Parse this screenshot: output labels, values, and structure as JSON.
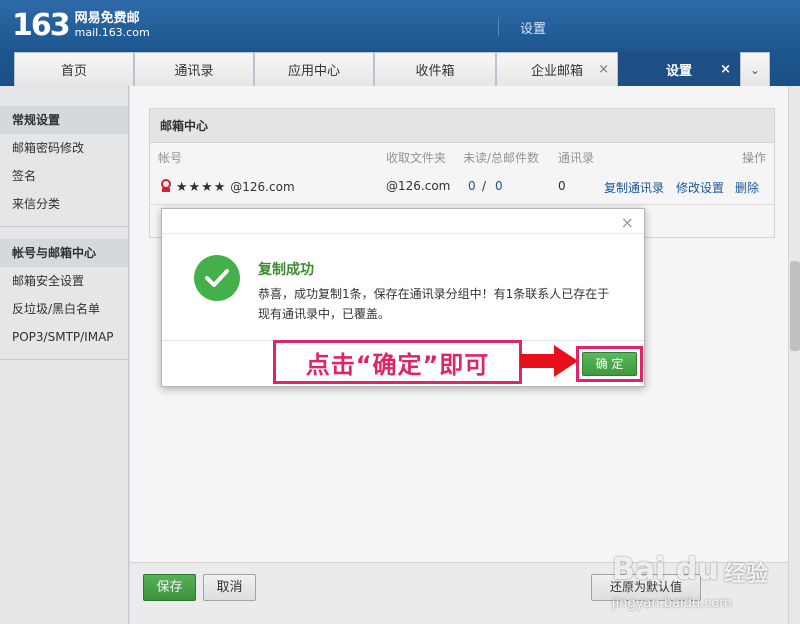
{
  "header": {
    "logo_number": "163",
    "logo_name": "网易免费邮",
    "logo_domain": "mail.163.com",
    "title": "设置"
  },
  "tabs": [
    {
      "label": "首页"
    },
    {
      "label": "通讯录"
    },
    {
      "label": "应用中心"
    },
    {
      "label": "收件箱"
    },
    {
      "label": "企业邮箱",
      "close": "×"
    },
    {
      "label": "设置",
      "close": "×",
      "active": true
    }
  ],
  "tab_more": "⌄",
  "sidebar": {
    "group1": {
      "title": "常规设置",
      "items": [
        "邮箱密码修改",
        "签名",
        "来信分类"
      ]
    },
    "group2": {
      "title": "帐号与邮箱中心",
      "items": [
        "邮箱安全设置",
        "反垃圾/黑白名单",
        "POP3/SMTP/IMAP"
      ]
    }
  },
  "panel": {
    "title": "邮箱中心",
    "columns": {
      "account": "帐号",
      "folder": "收取文件夹",
      "unread": "未读/总邮件数",
      "contacts": "通讯录",
      "actions": "操作"
    },
    "row": {
      "account_masked": "★★★★",
      "account_domain": "@126.com",
      "folder": "@126.com",
      "unread": "0",
      "sep": "/",
      "total": "0",
      "contacts": "0",
      "action_copy": "复制通讯录",
      "action_edit": "修改设置",
      "action_delete": "删除"
    }
  },
  "footer": {
    "save": "保存",
    "cancel": "取消",
    "reset": "还原为默认值"
  },
  "dialog": {
    "close": "×",
    "title": "复制成功",
    "message": "恭喜，成功复制1条，保存在通讯录分组中！有1条联系人已存在于现有通讯录中，已覆盖。",
    "ok": "确 定"
  },
  "annotation": {
    "text": "点击“确定”即可"
  },
  "watermark": {
    "brand": "Bai du",
    "jingyan": "经验",
    "url": "jingyan.baidu.com"
  },
  "colors": {
    "header_blue": "#1d568f",
    "success_green": "#43b04a",
    "annotation_pink": "#e0246a",
    "link_blue": "#1c5a9e"
  }
}
